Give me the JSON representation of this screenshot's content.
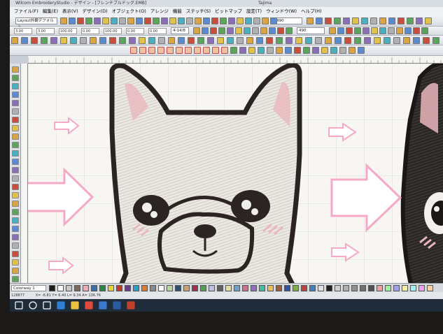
{
  "window": {
    "title": "Wilcom EmbroideryStudio - デザイン - [フレンチブルドッグ.EMB]",
    "right_title": "Tajima"
  },
  "menu": [
    "ファイル(F)",
    "編集(E)",
    "表示(V)",
    "デザイン(D)",
    "オブジェクト(O)",
    "アレンジ",
    "機能",
    "ステッチ(S)",
    "ビットマップ",
    "設定(T)",
    "ウィンドウ(W)",
    "ヘルプ(H)"
  ],
  "toolbar": {
    "layout_dropdown": "Layout外観デフォルト",
    "hoop_dropdown": "4-14/8",
    "width_field": "490",
    "height_field": "490",
    "fields_row2": [
      "3.00",
      "3.00",
      "100.00",
      "0.00",
      "100.00",
      "0.00",
      "0.00"
    ]
  },
  "palette": {
    "colorway_label": "Colorway 1",
    "colors": [
      "#1e1a18",
      "#ffffff",
      "#c9c9c9",
      "#7a6a5e",
      "#f2a9b8",
      "#3a6fb4",
      "#1f8a4a",
      "#e8d23a",
      "#c63a2a",
      "#6a3b8a",
      "#2aa0c8",
      "#e07a2a",
      "#8a8a8a",
      "#ffffff",
      "#b8d8a0",
      "#305070",
      "#d0a070",
      "#a03050",
      "#50a050",
      "#c0c0e0",
      "#606060",
      "#e0e0a0",
      "#70a0d0",
      "#d07090",
      "#9070c0",
      "#40c0a0",
      "#f0c060",
      "#a06040",
      "#3050a0",
      "#80b040",
      "#c04040",
      "#4080c0",
      "#e0e0e0",
      "#202020",
      "#d0d0d0",
      "#b0b0b0",
      "#909090",
      "#707070",
      "#505050",
      "#f0a0a0",
      "#a0f0a0",
      "#a0a0f0",
      "#f0f0a0",
      "#a0f0f0",
      "#f0a0f0",
      "#ffd0a0"
    ]
  },
  "status": {
    "stitch_count": "128877",
    "coords": "X= -6.81 Y= 6.40 L= 9.34 A= 136.76"
  },
  "canvas": {
    "arrow_color": "#f6a9c6",
    "dog_white_fill": "#eceae4",
    "dog_black_fill": "#2a2624",
    "outline": "#2b2422",
    "ear_pink": "#eab6bd"
  },
  "taskbar": {
    "icons": [
      "windows-icon",
      "search-icon",
      "task-view-icon",
      "edge-icon",
      "explorer-icon",
      "chrome-icon",
      "store-icon",
      "wilcom-icon",
      "wilcom2-icon"
    ]
  }
}
